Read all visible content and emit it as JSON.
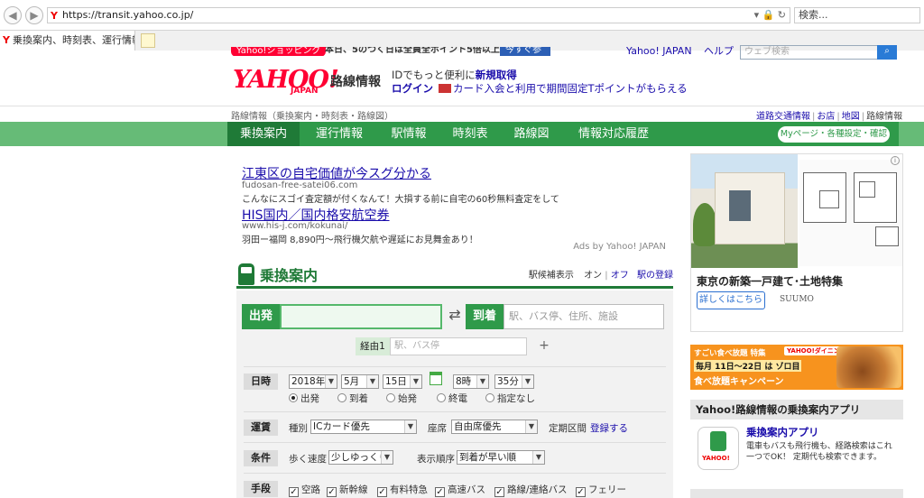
{
  "browser": {
    "url": "https://transit.yahoo.co.jp/",
    "search_placeholder": "検索...",
    "tab_title": "乗換案内、時刻表、運行情報 ..."
  },
  "top": {
    "promo_pill": "Yahoo!ショッピング",
    "promo_text": "本日、5のつく日は全員全ポイント5倍以上！",
    "promo_button": "今すぐ参加",
    "yahoo_japan_link": "Yahoo! JAPAN",
    "help_link": "ヘルプ",
    "web_search_placeholder": "ウェブ検索"
  },
  "header": {
    "logo": "YAHOO!",
    "logo_sub": "JAPAN",
    "service_name": "路線情報",
    "id_text": "IDでもっと便利に",
    "register_link": "新規取得",
    "login_link": "ログイン",
    "tpoint_text": "カード入会と利用で期間固定Tポイントがもらえる"
  },
  "breadcrumb": "路線情報（乗換案内・時刻表・路線図）",
  "util_links": [
    "道路交通情報",
    "お店",
    "地図",
    "路線情報"
  ],
  "nav": {
    "items": [
      "乗換案内",
      "運行情報",
      "駅情報",
      "時刻表",
      "路線図",
      "情報対応履歴"
    ],
    "mypage": "Myページ・各種設定・確認"
  },
  "ads": [
    {
      "title": "江東区の自宅価値が今スグ分かる",
      "url": "fudosan-free-satei06.com",
      "desc": "こんなにスゴイ査定額が付くなんて！大損する前に自宅の60秒無料査定をして"
    },
    {
      "title": "HIS国内／国内格安航空券",
      "url": "www.his-j.com/kokunai/",
      "desc": "羽田ー福岡 8,890円～飛行機欠航や遅延にお見舞金あり！"
    }
  ],
  "ads_by": "Ads by Yahoo! JAPAN",
  "transfer": {
    "title": "乗換案内",
    "station_opts_label": "駅候補表示",
    "on": "オン",
    "off": "オフ",
    "register_station": "駅の登録",
    "dep_label": "出発",
    "dep_value": "",
    "arr_label": "到着",
    "arr_placeholder": "駅、バス停、住所、施設",
    "via_label": "経由1",
    "via_placeholder": "駅、バス停",
    "datetime_label": "日時",
    "year": "2018年",
    "month": "5月",
    "day": "15日",
    "hour": "8時",
    "minute": "35分",
    "time_types": [
      "出発",
      "到着",
      "始発",
      "終電",
      "指定なし"
    ],
    "fare_label": "運賃",
    "type_label": "種別",
    "type_value": "ICカード優先",
    "seat_label": "座席",
    "seat_value": "自由席優先",
    "pass_label": "定期区間",
    "pass_link": "登録する",
    "cond_label": "条件",
    "walk_label": "歩く速度",
    "walk_value": "少しゆっくり",
    "order_label": "表示順序",
    "order_value": "到着が早い順",
    "means_label": "手段",
    "means": [
      "空路",
      "新幹線",
      "有料特急",
      "高速バス",
      "路線/連絡バス",
      "フェリー"
    ]
  },
  "side_ad": {
    "title": "東京の新築一戸建て･土地特集",
    "button": "詳しくはこちら",
    "brand": "SUUMO",
    "info": "i"
  },
  "food_banner": {
    "line1": "すごい食べ放題 特集",
    "logo": "YAHOO!ダイニング",
    "line2": "毎月 11日～22日 は ゾロ目",
    "line3": "食べ放題キャンペーン"
  },
  "app": {
    "heading": "Yahoo!路線情報の乗換案内アプリ",
    "name": "乗換案内アプリ",
    "desc": "電車もバスも飛行機も、経路検索はこれ一つでOK！ 定期代も検索できます。",
    "icon_brand": "YAHOO!"
  }
}
